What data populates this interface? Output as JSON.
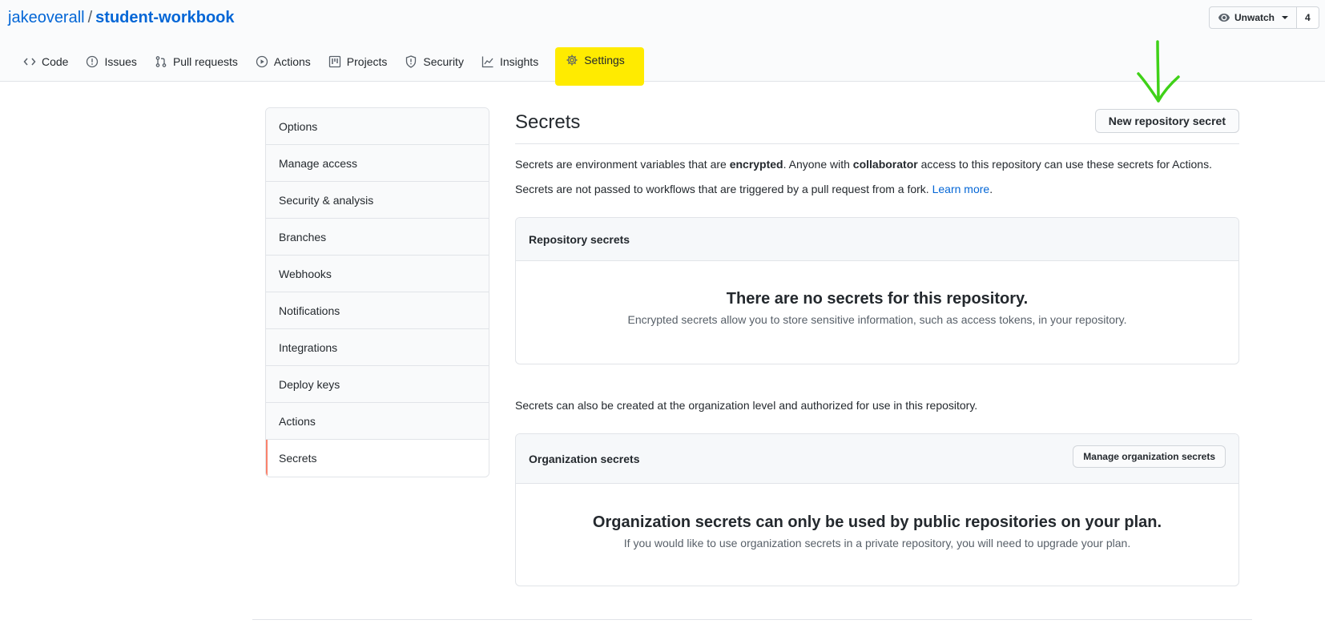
{
  "repo": {
    "owner": "jakeoverall",
    "separator": "/",
    "name": "student-workbook"
  },
  "watch": {
    "label": "Unwatch",
    "count": "4"
  },
  "nav": [
    {
      "label": "Code",
      "icon": "code-icon"
    },
    {
      "label": "Issues",
      "icon": "issue-opened-icon"
    },
    {
      "label": "Pull requests",
      "icon": "git-pull-request-icon"
    },
    {
      "label": "Actions",
      "icon": "play-icon"
    },
    {
      "label": "Projects",
      "icon": "project-icon"
    },
    {
      "label": "Security",
      "icon": "shield-icon"
    },
    {
      "label": "Insights",
      "icon": "graph-icon"
    },
    {
      "label": "Settings",
      "icon": "gear-icon",
      "selected": true
    }
  ],
  "highlight_color": "#ffeb00",
  "sidebar": [
    {
      "label": "Options"
    },
    {
      "label": "Manage access"
    },
    {
      "label": "Security & analysis"
    },
    {
      "label": "Branches"
    },
    {
      "label": "Webhooks"
    },
    {
      "label": "Notifications"
    },
    {
      "label": "Integrations"
    },
    {
      "label": "Deploy keys"
    },
    {
      "label": "Actions"
    },
    {
      "label": "Secrets",
      "selected": true
    }
  ],
  "main": {
    "title": "Secrets",
    "new_secret_button": "New repository secret",
    "intro": {
      "p1": "Secrets are environment variables that are",
      "p1_bold1": "encrypted",
      "p1_mid": ". Anyone with",
      "p1_bold2": "collaborator",
      "p1_end": "access to this repository can use these secrets for Actions.",
      "p2": "Secrets are not passed to workflows that are triggered by a pull request from a fork.",
      "learn_more": "Learn more"
    },
    "repo_secrets": {
      "header": "Repository secrets",
      "empty_title": "There are no secrets for this repository.",
      "empty_text": "Encrypted secrets allow you to store sensitive information, such as access tokens, in your repository."
    },
    "org_note": "Secrets can also be created at the organization level and authorized for use in this repository.",
    "org_secrets": {
      "header": "Organization secrets",
      "manage_button": "Manage organization secrets",
      "empty_title": "Organization secrets can only be used by public repositories on your plan.",
      "empty_text": "If you would like to use organization secrets in a private repository, you will need to upgrade your plan."
    }
  },
  "annotation": {
    "arrow_color": "#3fd118"
  }
}
